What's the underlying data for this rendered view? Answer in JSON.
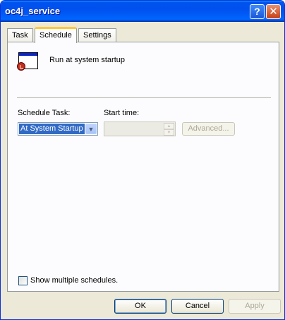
{
  "window": {
    "title": "oc4j_service",
    "help_glyph": "?",
    "close_glyph": "✕"
  },
  "tabs": [
    {
      "label": "Task",
      "active": false
    },
    {
      "label": "Schedule",
      "active": true
    },
    {
      "label": "Settings",
      "active": false
    }
  ],
  "schedule": {
    "icon": "scheduled-task-window-clock-icon",
    "summary": "Run at system startup",
    "schedule_task_label": "Schedule Task:",
    "schedule_task_value": "At System Startup",
    "start_time_label": "Start time:",
    "start_time_value": "",
    "advanced_label": "Advanced...",
    "show_multiple_label": "Show multiple schedules.",
    "show_multiple_checked": false
  },
  "footer": {
    "ok_label": "OK",
    "cancel_label": "Cancel",
    "apply_label": "Apply"
  },
  "colors": {
    "titlebar": "#0054e3",
    "dialog_bg": "#ece9d8",
    "selection": "#316ac5",
    "active_tab_accent": "#ffc83c"
  }
}
